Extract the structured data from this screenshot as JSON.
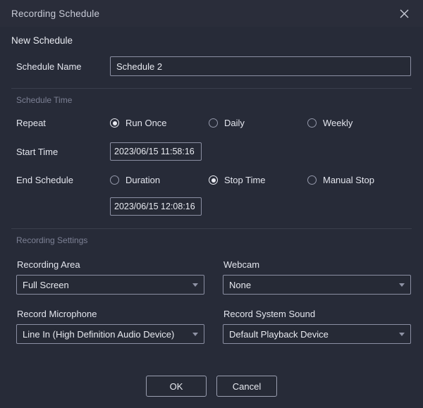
{
  "window": {
    "title": "Recording Schedule",
    "close_icon": "close-icon"
  },
  "subtitle": "New Schedule",
  "schedule_name": {
    "label": "Schedule Name",
    "value": "Schedule 2",
    "placeholder": "Schedule Name"
  },
  "schedule_time": {
    "section_label": "Schedule Time",
    "repeat": {
      "label": "Repeat",
      "options": [
        {
          "label": "Run Once",
          "selected": true
        },
        {
          "label": "Daily",
          "selected": false
        },
        {
          "label": "Weekly",
          "selected": false
        }
      ]
    },
    "start_time": {
      "label": "Start Time",
      "value": "2023/06/15 11:58:16"
    },
    "end_schedule": {
      "label": "End Schedule",
      "options": [
        {
          "label": "Duration",
          "selected": false
        },
        {
          "label": "Stop Time",
          "selected": true
        },
        {
          "label": "Manual Stop",
          "selected": false
        }
      ],
      "value": "2023/06/15 12:08:16"
    }
  },
  "recording_settings": {
    "section_label": "Recording Settings",
    "recording_area": {
      "label": "Recording Area",
      "value": "Full Screen"
    },
    "webcam": {
      "label": "Webcam",
      "value": "None"
    },
    "record_microphone": {
      "label": "Record Microphone",
      "value": "Line In (High Definition Audio Device)"
    },
    "record_system_sound": {
      "label": "Record System Sound",
      "value": "Default Playback Device"
    }
  },
  "footer": {
    "ok_label": "OK",
    "cancel_label": "Cancel"
  },
  "colors": {
    "background": "#272b38",
    "titlebar": "#2a2d3a",
    "border": "#8b8fa3",
    "text": "#e8eaf0",
    "muted_text": "#7c8094",
    "divider": "#3a3e4c"
  }
}
